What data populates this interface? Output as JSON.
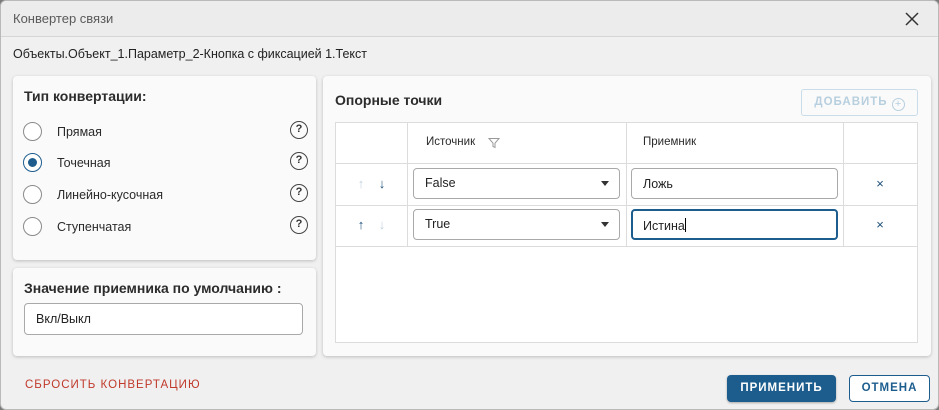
{
  "window": {
    "title": "Конвертер связи"
  },
  "path": "Объекты.Объект_1.Параметр_2-Кнопка с фиксацией 1.Текст",
  "conversion_type": {
    "title": "Тип конвертации:",
    "options": [
      {
        "label": "Прямая",
        "selected": false
      },
      {
        "label": "Точечная",
        "selected": true
      },
      {
        "label": "Линейно-кусочная",
        "selected": false
      },
      {
        "label": "Ступенчатая",
        "selected": false
      }
    ],
    "help_glyph": "?"
  },
  "default_value": {
    "title": "Значение приемника по умолчанию :",
    "value": "Вкл/Выкл"
  },
  "points": {
    "title": "Опорные точки",
    "add_label": "ДОБАВИТЬ",
    "columns": {
      "source": "Источник",
      "target": "Приемник"
    },
    "rows": [
      {
        "source": "False",
        "target": "Ложь",
        "up_enabled": false,
        "down_enabled": true
      },
      {
        "source": "True",
        "target": "Истина",
        "up_enabled": true,
        "down_enabled": false
      }
    ],
    "delete_glyph": "×"
  },
  "footer": {
    "reset_label": "СБРОСИТЬ КОНВЕРТАЦИЮ",
    "apply_label": "ПРИМЕНИТЬ",
    "cancel_label": "ОТМЕНА"
  },
  "colors": {
    "accent": "#1d5d8e",
    "danger": "#c0392b",
    "disabled": "#b7cfdf"
  }
}
